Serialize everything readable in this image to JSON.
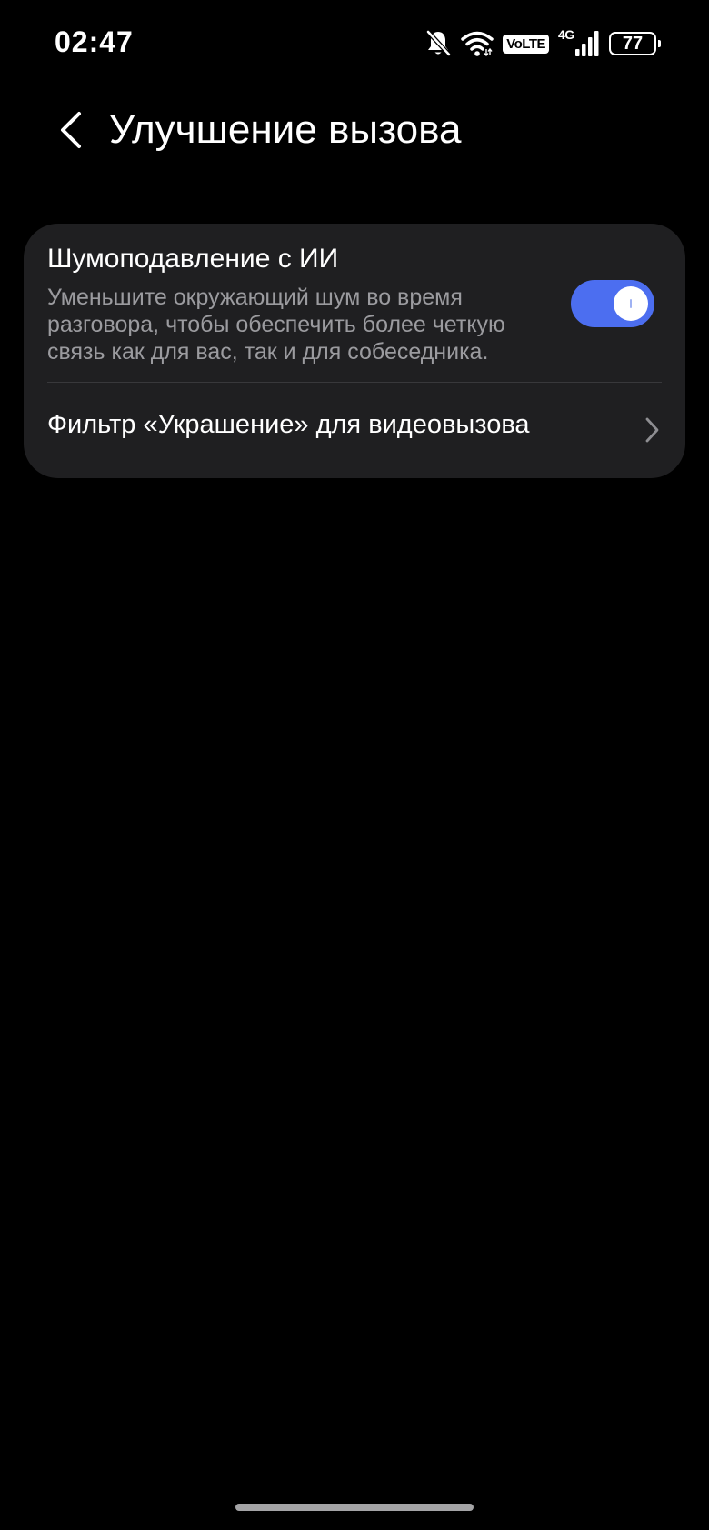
{
  "status_bar": {
    "time": "02:47",
    "volte": "VoLTE",
    "network": "4G",
    "battery": "77",
    "icons": [
      "bell-off-icon",
      "wifi-icon",
      "volte-icon",
      "signal-icon",
      "battery-icon"
    ]
  },
  "header": {
    "title": "Улучшение вызова",
    "back_icon": "chevron-left-icon"
  },
  "settings": {
    "noise_suppression": {
      "title": "Шумоподавление с ИИ",
      "description": "Уменьшите окружающий шум во время разговора, чтобы обеспечить более четкую связь как для вас, так и для собеседника.",
      "enabled": true
    },
    "video_filter": {
      "label": "Фильтр «Украшение» для видеовызова",
      "icon": "chevron-right-icon"
    }
  },
  "colors": {
    "background": "#000000",
    "card": "#1f1f21",
    "toggle_on": "#4c6ef0",
    "secondary_text": "#9b9b9f"
  }
}
